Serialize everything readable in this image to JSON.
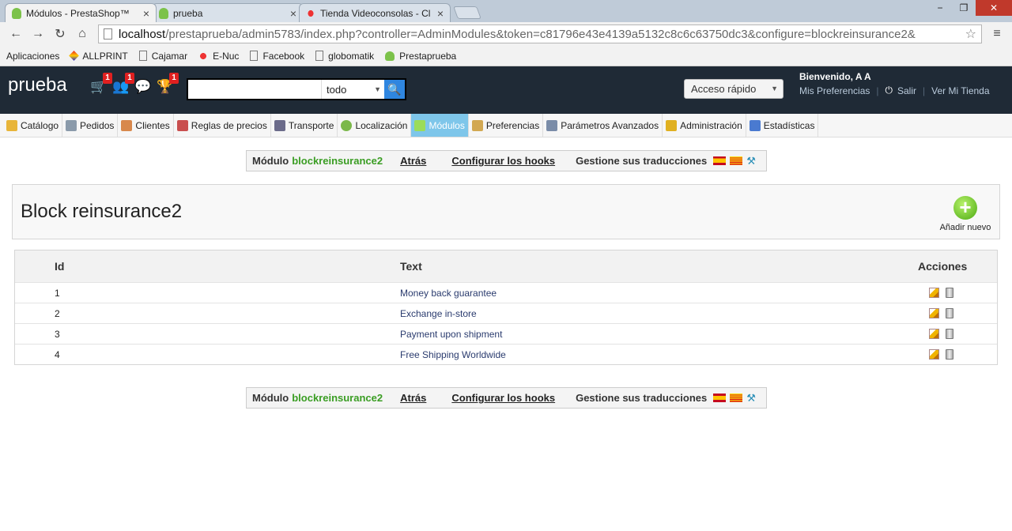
{
  "browser": {
    "tabs": [
      {
        "label": "Módulos - PrestaShop™",
        "active": true,
        "close": "×"
      },
      {
        "label": "prueba",
        "active": false,
        "close": "×"
      },
      {
        "label": "Tienda Videoconsolas - Cl",
        "active": false,
        "close": "×"
      }
    ],
    "window_controls": {
      "minimize": "−",
      "restore": "❐",
      "close": "✕"
    },
    "nav": {
      "back": "←",
      "forward": "→",
      "reload": "↻",
      "home": "⌂",
      "star": "☆",
      "menu": "≡"
    },
    "url_host": "localhost",
    "url_path": "/prestaprueba/admin5783/index.php?controller=AdminModules&token=c81796e43e4139a5132c8c6c63750dc3&configure=blockreinsurance2&",
    "bookmarks": [
      "Aplicaciones",
      "ALLPRINT",
      "Cajamar",
      "E-Nuc",
      "Facebook",
      "globomatik",
      "Prestaprueba"
    ]
  },
  "header": {
    "brand": "prueba",
    "badges": {
      "orders": "1",
      "customers": "1",
      "messages": "1",
      "trophy": "1"
    },
    "search_scope": "todo",
    "quick_access": "Acceso rápido",
    "welcome": "Bienvenido, A A",
    "my_prefs": "Mis Preferencias",
    "logout": "Salir",
    "view_store": "Ver Mi Tienda"
  },
  "menu": [
    {
      "label": "Catálogo",
      "color": "#e8b53a"
    },
    {
      "label": "Pedidos",
      "color": "#8a9aaa"
    },
    {
      "label": "Clientes",
      "color": "#d8884c"
    },
    {
      "label": "Reglas de precios",
      "color": "#c94f4f"
    },
    {
      "label": "Transporte",
      "color": "#6b6b8a"
    },
    {
      "label": "Localización",
      "color": "#7bb84a"
    },
    {
      "label": "Módulos",
      "color": "#9bdc5a",
      "active": true
    },
    {
      "label": "Preferencias",
      "color": "#d2a852"
    },
    {
      "label": "Parámetros Avanzados",
      "color": "#7a8ca8"
    },
    {
      "label": "Administración",
      "color": "#e0b020"
    },
    {
      "label": "Estadísticas",
      "color": "#4a7ad0"
    }
  ],
  "module_bar": {
    "prefix": "Módulo",
    "module": "blockreinsurance2",
    "back": "Atrás",
    "hooks": "Configurar los hooks",
    "translations": "Gestione sus traducciones"
  },
  "panel": {
    "title": "Block reinsurance2",
    "add_new": "Añadir nuevo"
  },
  "table": {
    "headers": {
      "id": "Id",
      "text": "Text",
      "actions": "Acciones"
    },
    "rows": [
      {
        "id": "1",
        "text": "Money back guarantee"
      },
      {
        "id": "2",
        "text": "Exchange in-store"
      },
      {
        "id": "3",
        "text": "Payment upon shipment"
      },
      {
        "id": "4",
        "text": "Free Shipping Worldwide"
      }
    ]
  }
}
